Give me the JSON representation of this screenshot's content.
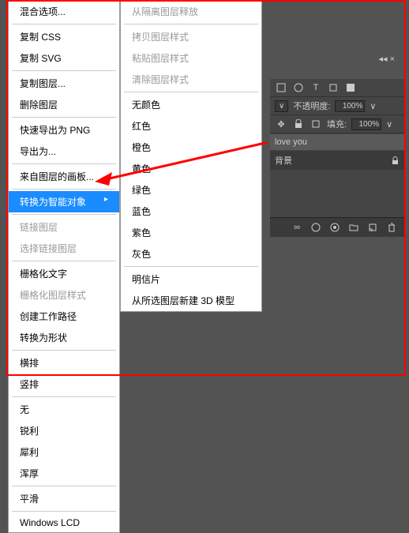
{
  "menu1": {
    "blending": "混合选项...",
    "copyCss": "复制 CSS",
    "copySvg": "复制 SVG",
    "dupLayer": "复制图层...",
    "delLayer": "删除图层",
    "quickExportPng": "快速导出为 PNG",
    "exportAs": "导出为...",
    "artboardFrom": "来自图层的画板...",
    "convertSmart": "转换为智能对象",
    "linkLayer": "链接图层",
    "selectLinked": "选择链接图层",
    "rasterizeType": "栅格化文字",
    "rasterizeStyle": "栅格化图层样式",
    "createWorkPath": "创建工作路径",
    "convertShape": "转换为形状",
    "horizontal": "横排",
    "vertical": "竖排",
    "none": "无",
    "sharp": "锐利",
    "crisp": "犀利",
    "strong": "浑厚",
    "smooth": "平滑",
    "winLcd": "Windows LCD"
  },
  "menu2": {
    "releaseIso": "从隔离图层释放",
    "copyStyle": "拷贝图层样式",
    "pasteStyle": "粘贴图层样式",
    "clearStyle": "清除图层样式",
    "noColor": "无颜色",
    "red": "红色",
    "orange": "橙色",
    "yellow": "黄色",
    "green": "绿色",
    "blue": "蓝色",
    "purple": "紫色",
    "gray": "灰色",
    "postcard": "明信片",
    "new3d": "从所选图层新建 3D 模型"
  },
  "panel": {
    "opacity": "不透明度:",
    "opacityVal": "100%",
    "fill": "填充:",
    "fillVal": "100%",
    "layer1": "love you",
    "layer2": "背景",
    "tabsClose": "×"
  }
}
